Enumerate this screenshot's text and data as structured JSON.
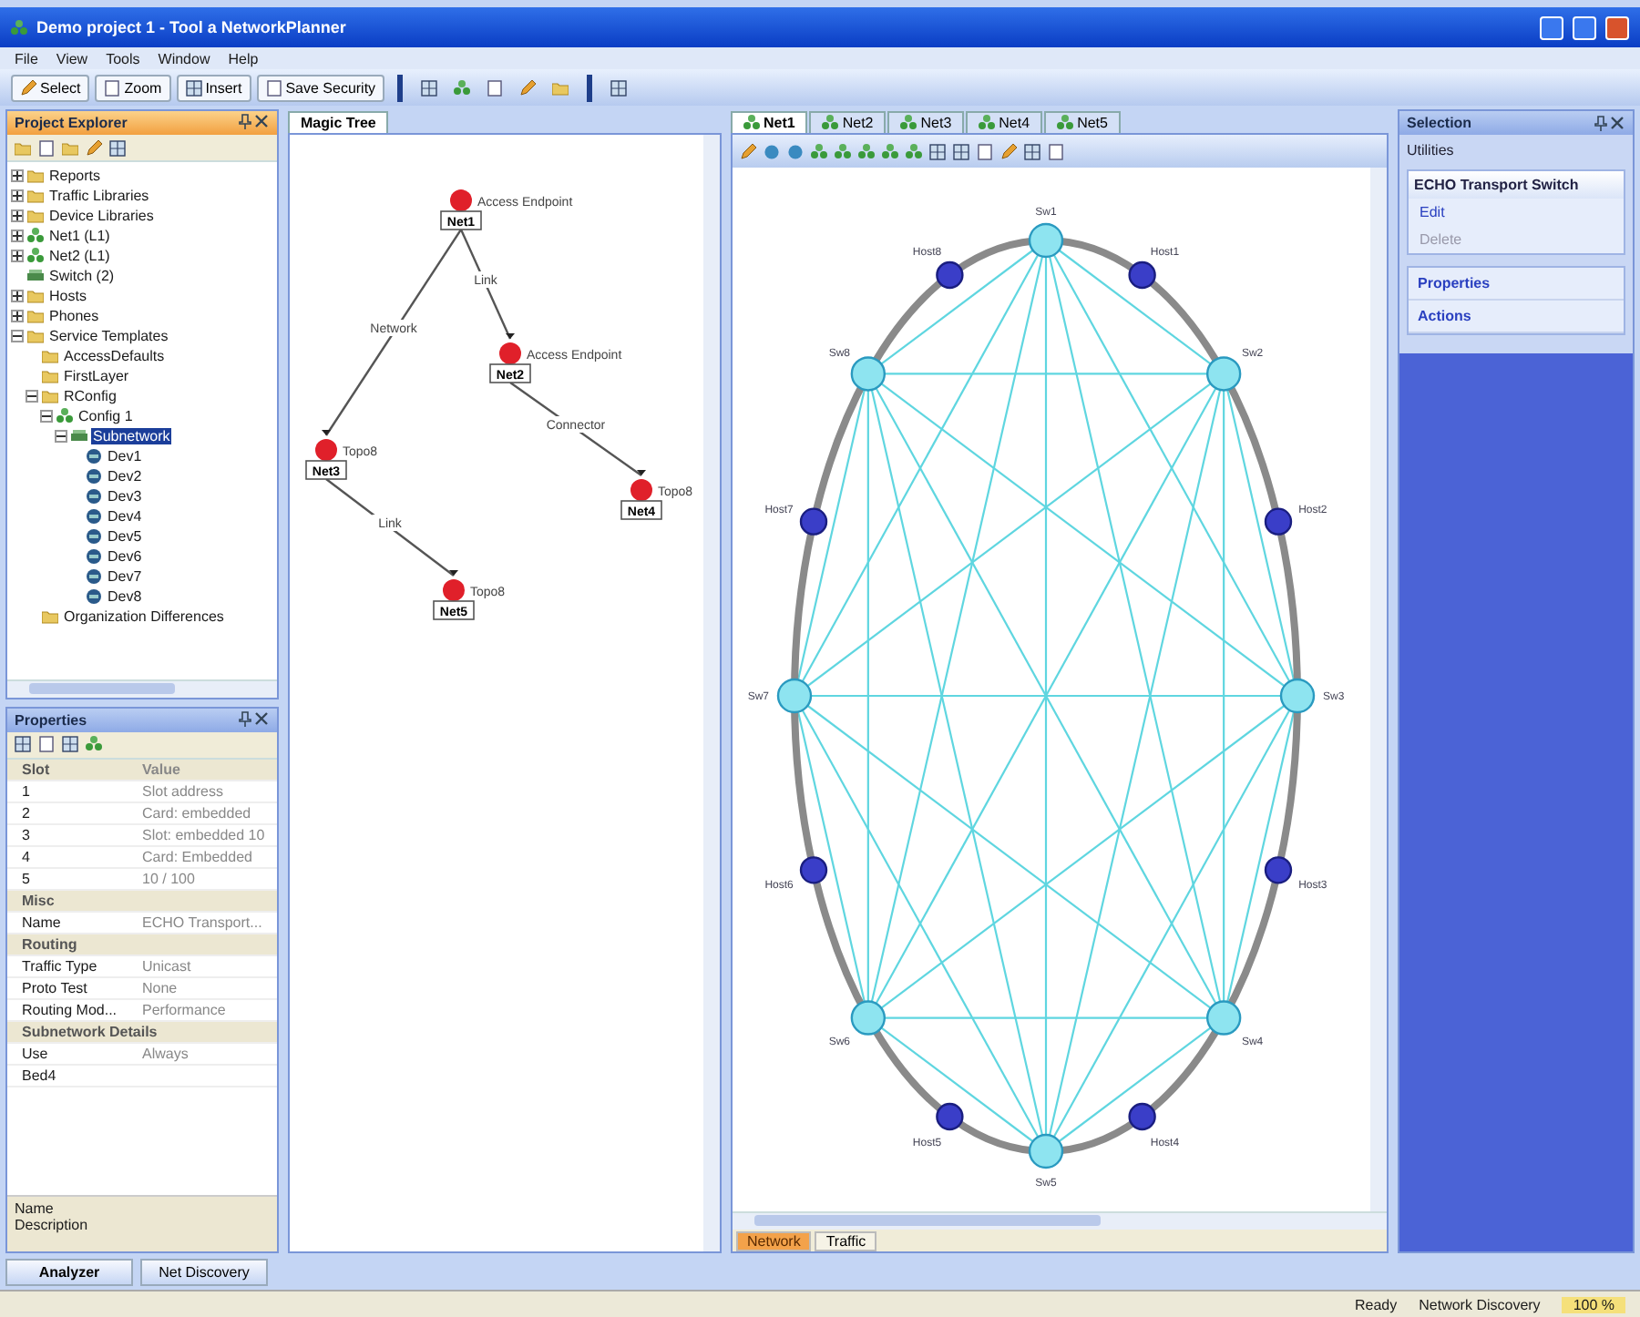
{
  "window": {
    "title": "Demo project 1 - Tool a NetworkPlanner"
  },
  "menu": [
    "File",
    "View",
    "Tools",
    "Window",
    "Help"
  ],
  "toolbar": [
    "Select",
    "Zoom",
    "Insert",
    "Save Security"
  ],
  "project_explorer": {
    "title": "Project Explorer",
    "tree": [
      {
        "label": "Reports",
        "kind": "folder",
        "expanded": false,
        "selected": false
      },
      {
        "label": "Traffic Libraries",
        "kind": "folder",
        "expanded": false,
        "selected": false
      },
      {
        "label": "Device Libraries",
        "kind": "folder",
        "expanded": false,
        "selected": false
      },
      {
        "label": "Net1 (L1)",
        "kind": "network",
        "expanded": false,
        "selected": false
      },
      {
        "label": "Net2 (L1)",
        "kind": "network",
        "expanded": false,
        "selected": false
      },
      {
        "label": "Switch (2)",
        "kind": "switch",
        "selected": false
      },
      {
        "label": "Hosts",
        "kind": "folder",
        "expanded": false,
        "selected": false
      },
      {
        "label": "Phones",
        "kind": "folder",
        "expanded": false,
        "selected": false
      },
      {
        "label": "Service Templates",
        "kind": "folder",
        "expanded": true,
        "selected": false,
        "children": [
          {
            "label": "AccessDefaults",
            "kind": "folder",
            "selected": false
          },
          {
            "label": "FirstLayer",
            "kind": "folder",
            "selected": false
          },
          {
            "label": "RConfig",
            "kind": "folder",
            "expanded": true,
            "selected": false,
            "children": [
              {
                "label": "Config 1",
                "kind": "network",
                "expanded": true,
                "selected": false,
                "children": [
                  {
                    "label": "Subnetwork",
                    "kind": "switch",
                    "expanded": true,
                    "selected": true,
                    "children": [
                      {
                        "label": "Dev1",
                        "kind": "device",
                        "selected": false
                      },
                      {
                        "label": "Dev2",
                        "kind": "device",
                        "selected": false
                      },
                      {
                        "label": "Dev3",
                        "kind": "device",
                        "selected": false
                      },
                      {
                        "label": "Dev4",
                        "kind": "device",
                        "selected": false
                      },
                      {
                        "label": "Dev5",
                        "kind": "device",
                        "selected": false
                      },
                      {
                        "label": "Dev6",
                        "kind": "device",
                        "selected": false
                      },
                      {
                        "label": "Dev7",
                        "kind": "device",
                        "selected": false
                      },
                      {
                        "label": "Dev8",
                        "kind": "device",
                        "selected": false
                      }
                    ]
                  }
                ]
              }
            ]
          },
          {
            "label": "Organization Differences",
            "kind": "folder",
            "selected": false
          }
        ]
      }
    ]
  },
  "properties": {
    "title": "Properties",
    "rows": [
      {
        "kind": "category",
        "name": "Slot",
        "value": "Value"
      },
      {
        "kind": "property",
        "name": "1",
        "value": "Slot address"
      },
      {
        "kind": "property",
        "name": "2",
        "value": "Card: embedded"
      },
      {
        "kind": "property",
        "name": "3",
        "value": "Slot: embedded 10"
      },
      {
        "kind": "property",
        "name": "4",
        "value": "Card: Embedded"
      },
      {
        "kind": "property",
        "name": "5",
        "value": "10 / 100"
      },
      {
        "kind": "category",
        "name": "Misc",
        "value": ""
      },
      {
        "kind": "property",
        "name": "Name",
        "value": "ECHO Transport..."
      },
      {
        "kind": "category",
        "name": "Routing",
        "value": ""
      },
      {
        "kind": "property",
        "name": "Traffic Type",
        "value": "Unicast"
      },
      {
        "kind": "property",
        "name": "Proto Test",
        "value": "None"
      },
      {
        "kind": "property",
        "name": "Routing Mod...",
        "value": "Performance"
      },
      {
        "kind": "category",
        "name": "Subnetwork Details",
        "value": ""
      },
      {
        "kind": "property",
        "name": "Use",
        "value": "Always"
      },
      {
        "kind": "property",
        "name": "Bed4",
        "value": ""
      }
    ],
    "description_title": "Name",
    "description": "Description"
  },
  "magic_tree": {
    "tab": "Magic Tree",
    "root": {
      "label": "Net1",
      "caption": "Access Endpoint",
      "children": [
        {
          "edge": "Network",
          "label": "Net3",
          "caption": "Topo8",
          "children": [
            {
              "edge": "Link",
              "label": "Net5",
              "caption": "Topo8"
            }
          ]
        },
        {
          "edge": "Link",
          "label": "Net2",
          "caption": "Access Endpoint",
          "children": [
            {
              "edge": "Connector",
              "label": "Net4",
              "caption": "Topo8"
            }
          ]
        }
      ]
    }
  },
  "diagram": {
    "tabs": [
      {
        "label": "Net1",
        "selected": true
      },
      {
        "label": "Net2",
        "selected": false
      },
      {
        "label": "Net3",
        "selected": false
      },
      {
        "label": "Net4",
        "selected": false
      },
      {
        "label": "Net5",
        "selected": false
      }
    ],
    "nodes": [
      {
        "label": "Sw1",
        "kind": "switch"
      },
      {
        "label": "Host1",
        "kind": "host"
      },
      {
        "label": "Sw2",
        "kind": "switch"
      },
      {
        "label": "Host2",
        "kind": "host"
      },
      {
        "label": "Sw3",
        "kind": "switch"
      },
      {
        "label": "Host3",
        "kind": "host"
      },
      {
        "label": "Sw4",
        "kind": "switch"
      },
      {
        "label": "Host4",
        "kind": "host"
      },
      {
        "label": "Sw5",
        "kind": "switch"
      },
      {
        "label": "Host5",
        "kind": "host"
      },
      {
        "label": "Sw6",
        "kind": "switch"
      },
      {
        "label": "Host6",
        "kind": "host"
      },
      {
        "label": "Sw7",
        "kind": "switch"
      },
      {
        "label": "Host7",
        "kind": "host"
      },
      {
        "label": "Sw8",
        "kind": "switch"
      },
      {
        "label": "Host8",
        "kind": "host"
      }
    ],
    "bottom_tabs": [
      {
        "label": "Network",
        "selected": true
      },
      {
        "label": "Traffic",
        "selected": false
      }
    ]
  },
  "selection": {
    "title": "Selection",
    "dropdown": "Utilities",
    "card": {
      "title": "ECHO Transport Switch",
      "items": [
        "Edit",
        "Delete"
      ]
    },
    "sections": [
      "Properties",
      "Actions"
    ]
  },
  "bottom_tabs": [
    {
      "label": "Analyzer",
      "selected": true
    },
    {
      "label": "Net Discovery",
      "selected": false
    }
  ],
  "status_bar": [
    "Ready",
    "Network Discovery",
    "100 %"
  ]
}
